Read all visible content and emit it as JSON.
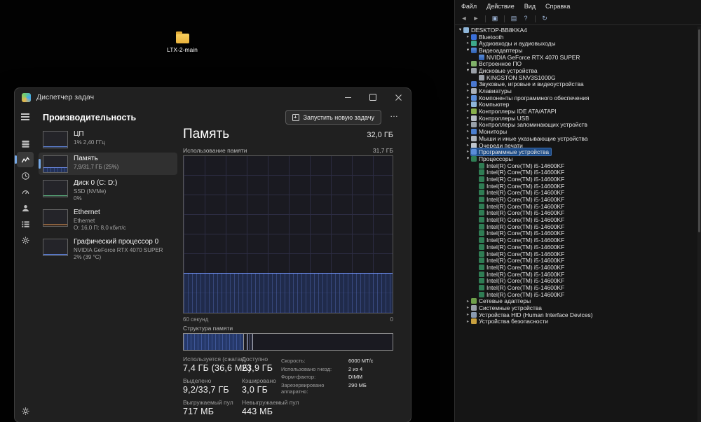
{
  "desktop": {
    "icon_label": "LTX-2-main"
  },
  "task_manager": {
    "title": "Диспетчер задач",
    "page_title": "Производительность",
    "run_task_button": "Запустить новую задачу",
    "more_button": "…",
    "rail": [
      {
        "name": "processes"
      },
      {
        "name": "performance",
        "selected": true
      },
      {
        "name": "app-history"
      },
      {
        "name": "startup-apps"
      },
      {
        "name": "users"
      },
      {
        "name": "details"
      },
      {
        "name": "services"
      }
    ],
    "sidebar": [
      {
        "kind": "cpu",
        "title": "ЦП",
        "lines": [
          "1% 2,40 ГГц"
        ],
        "thumb_fill_percent": 4
      },
      {
        "kind": "memory",
        "title": "Память",
        "lines": [
          "7,9/31,7 ГБ (25%)"
        ],
        "thumb_fill_percent": 25,
        "selected": true
      },
      {
        "kind": "disk",
        "title": "Диск 0 (C: D:)",
        "lines": [
          "SSD (NVMe)",
          "0%"
        ],
        "thumb_fill_percent": 3
      },
      {
        "kind": "ethernet",
        "title": "Ethernet",
        "lines": [
          "Ethernet",
          "О: 16,0 П: 8,0 кбит/с"
        ],
        "thumb_fill_percent": 8
      },
      {
        "kind": "gpu",
        "title": "Графический процессор 0",
        "lines": [
          "NVIDIA GeForce RTX 4070 SUPER",
          "2% (39 °C)"
        ],
        "thumb_fill_percent": 4
      }
    ],
    "main": {
      "title": "Память",
      "total": "32,0 ГБ",
      "usage_caption": "Использование памяти",
      "usage_max": "31,7 ГБ",
      "time_left": "60 секунд",
      "time_right": "0",
      "composition_caption": "Структура памяти",
      "stats_columns": [
        [
          {
            "label": "Используется (сжатая)",
            "value": "7,4 ГБ (36,6 МБ)"
          },
          {
            "label": "Выделено",
            "value": "9,2/33,7 ГБ"
          },
          {
            "label": "Выгружаемый пул",
            "value": "717 МБ"
          }
        ],
        [
          {
            "label": "Доступно",
            "value": "23,9 ГБ"
          },
          {
            "label": "Кэшировано",
            "value": "3,0 ГБ"
          },
          {
            "label": "Невыгружаемый пул",
            "value": "443 МБ"
          }
        ]
      ],
      "hw_info": [
        {
          "label": "Скорость:",
          "value": "6000 МТ/с"
        },
        {
          "label": "Использовано гнезд:",
          "value": "2 из 4"
        },
        {
          "label": "Форм-фактор:",
          "value": "DIMM"
        },
        {
          "label": "Зарезервировано аппаратно:",
          "value": "290 МБ"
        }
      ]
    }
  },
  "chart_data": {
    "type": "area",
    "title": "Использование памяти",
    "ylabel": "ГБ",
    "ylim": [
      0,
      31.7
    ],
    "x_axis": {
      "label_left": "60 секунд",
      "label_right": "0",
      "range_seconds": 60
    },
    "series": [
      {
        "name": "Память (ГБ)",
        "values": [
          7.9,
          7.9,
          7.9,
          7.9,
          7.9,
          7.9,
          7.9,
          7.9,
          7.9,
          7.9,
          7.9,
          7.9,
          7.9
        ]
      }
    ],
    "usage_percent": 25,
    "composition": {
      "label": "Структура памяти",
      "segments": [
        {
          "name": "in-use",
          "fraction": 0.29,
          "gap": 0.012,
          "gb": 7.4
        },
        {
          "name": "modified",
          "fraction": 0.03
        },
        {
          "name": "available",
          "fraction": 0.665,
          "gb": 23.9
        }
      ]
    }
  },
  "device_manager": {
    "menu": [
      "Файл",
      "Действие",
      "Вид",
      "Справка"
    ],
    "toolbar": [
      {
        "name": "back-icon",
        "glyph": "◄",
        "muted": true
      },
      {
        "name": "forward-icon",
        "glyph": "►",
        "muted": true
      },
      {
        "type": "separator"
      },
      {
        "name": "console-window-icon",
        "glyph": "▣"
      },
      {
        "type": "separator"
      },
      {
        "name": "properties-icon",
        "glyph": "▤"
      },
      {
        "name": "help-icon",
        "glyph": "?"
      },
      {
        "type": "separator"
      },
      {
        "name": "scan-hardware-icon",
        "glyph": "↻"
      }
    ],
    "tree": [
      {
        "label": "DESKTOP-BB8KKA4",
        "level": 0,
        "state": "expanded",
        "icon": "computer"
      },
      {
        "label": "Bluetooth",
        "level": 1,
        "state": "collapsed",
        "icon": "bluetooth"
      },
      {
        "label": "Аудиовходы и аудиовыходы",
        "level": 1,
        "state": "collapsed",
        "icon": "audio"
      },
      {
        "label": "Видеоадаптеры",
        "level": 1,
        "state": "expanded",
        "icon": "display"
      },
      {
        "label": "NVIDIA GeForce RTX 4070 SUPER",
        "level": 2,
        "state": "leaf",
        "icon": "display"
      },
      {
        "label": "Встроенное ПО",
        "level": 1,
        "state": "collapsed",
        "icon": "firmware"
      },
      {
        "label": "Дисковые устройства",
        "level": 1,
        "state": "expanded",
        "icon": "disk"
      },
      {
        "label": "KINGSTON SNV3S1000G",
        "level": 2,
        "state": "leaf",
        "icon": "disk"
      },
      {
        "label": "Звуковые, игровые и видеоустройства",
        "level": 1,
        "state": "collapsed",
        "icon": "sound"
      },
      {
        "label": "Клавиатуры",
        "level": 1,
        "state": "collapsed",
        "icon": "keyboard"
      },
      {
        "label": "Компоненты программного обеспечения",
        "level": 1,
        "state": "collapsed",
        "icon": "software"
      },
      {
        "label": "Компьютер",
        "level": 1,
        "state": "collapsed",
        "icon": "computer"
      },
      {
        "label": "Контроллеры IDE ATA/ATAPI",
        "level": 1,
        "state": "collapsed",
        "icon": "ide"
      },
      {
        "label": "Контроллеры USB",
        "level": 1,
        "state": "collapsed",
        "icon": "usb"
      },
      {
        "label": "Контроллеры запоминающих устройств",
        "level": 1,
        "state": "collapsed",
        "icon": "storage"
      },
      {
        "label": "Мониторы",
        "level": 1,
        "state": "collapsed",
        "icon": "monitor"
      },
      {
        "label": "Мыши и иные указывающие устройства",
        "level": 1,
        "state": "collapsed",
        "icon": "mouse"
      },
      {
        "label": "Очереди печати",
        "level": 1,
        "state": "collapsed",
        "icon": "printer"
      },
      {
        "label": "Программные устройства",
        "level": 1,
        "state": "collapsed",
        "icon": "software",
        "selected": true
      },
      {
        "label": "Процессоры",
        "level": 1,
        "state": "expanded",
        "icon": "cpu"
      },
      {
        "label": "Intel(R) Core(TM) i5-14600KF",
        "level": 2,
        "state": "leaf",
        "icon": "cpu",
        "count": 20
      },
      {
        "label": "Сетевые адаптеры",
        "level": 1,
        "state": "collapsed",
        "icon": "network"
      },
      {
        "label": "Системные устройства",
        "level": 1,
        "state": "collapsed",
        "icon": "system"
      },
      {
        "label": "Устройства HID (Human Interface Devices)",
        "level": 1,
        "state": "collapsed",
        "icon": "hid"
      },
      {
        "label": "Устройства безопасности",
        "level": 1,
        "state": "collapsed",
        "icon": "security"
      }
    ]
  }
}
